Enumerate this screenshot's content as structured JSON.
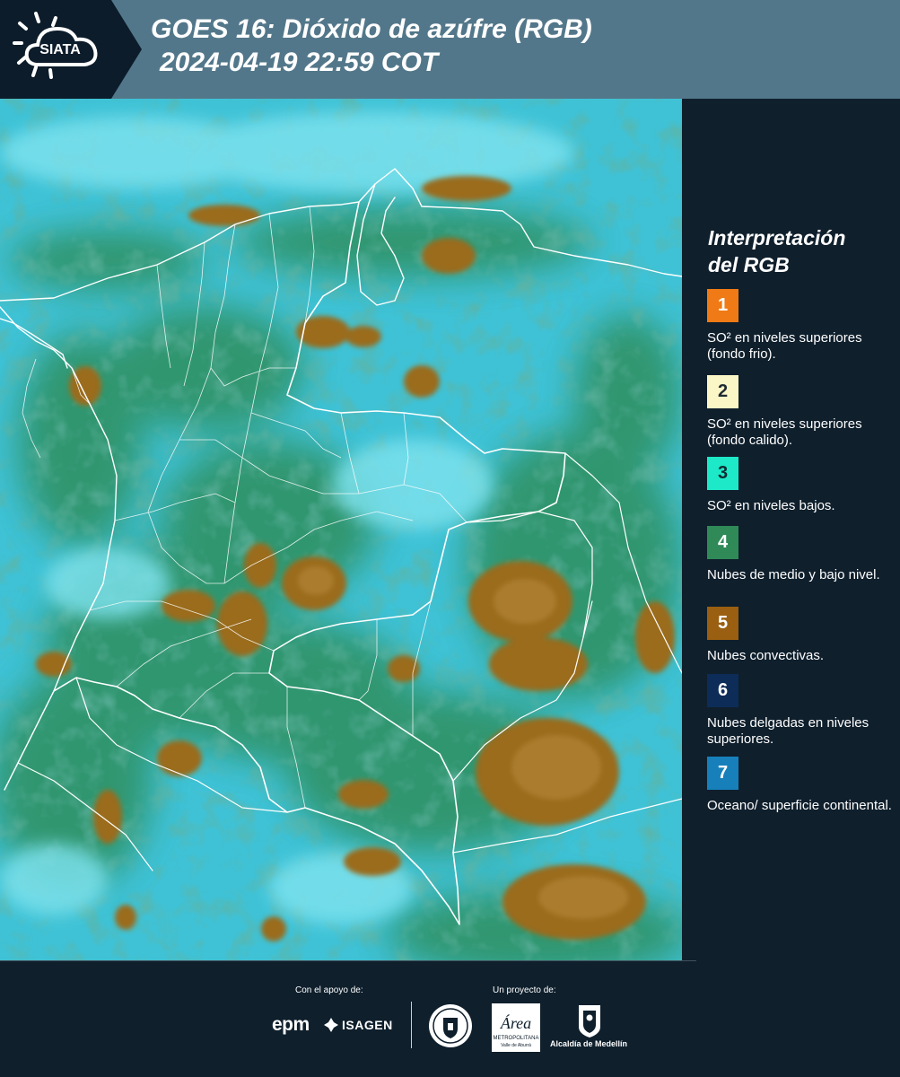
{
  "header": {
    "logo_text": "SIATA",
    "title_line1": "GOES 16: Dióxido de azúfre (RGB)",
    "title_line2": "2024-04-19 22:59 COT"
  },
  "legend": {
    "title_line1": "Interpretación",
    "title_line2": "del RGB",
    "items": [
      {
        "num": "1",
        "color": "#f07a15",
        "text_color": "#ffffff",
        "label": "SO² en niveles superiores (fondo frio)."
      },
      {
        "num": "2",
        "color": "#fbf6c6",
        "text_color": "#1e2a33",
        "label": "SO² en niveles superiores (fondo calido)."
      },
      {
        "num": "3",
        "color": "#1de9c9",
        "text_color": "#0f2b33",
        "label": "SO² en niveles bajos."
      },
      {
        "num": "4",
        "color": "#2f8a58",
        "text_color": "#ffffff",
        "label": "Nubes de medio y bajo nivel."
      },
      {
        "num": "5",
        "color": "#9a5f10",
        "text_color": "#ffffff",
        "label": "Nubes convectivas."
      },
      {
        "num": "6",
        "color": "#0d2c57",
        "text_color": "#ffffff",
        "label": "Nubes delgadas en niveles superiores."
      },
      {
        "num": "7",
        "color": "#1780bb",
        "text_color": "#ffffff",
        "label": "Oceano/ superficie continental."
      }
    ]
  },
  "footer": {
    "support_label": "Con el apoyo de:",
    "project_label": "Un proyecto de:",
    "sponsors": [
      "epm",
      "ISAGEN"
    ],
    "partners": [
      "Área Metropolitana Valle de Aburrá",
      "Alcaldía de Medellín"
    ],
    "epm_text": "epm",
    "isagen_text": "ISAGEN",
    "area_text": "Área",
    "area_sub": "METROPOLITANA",
    "area_sub2": "Valle de Aburrá",
    "alcaldia_text": "Alcaldía de Medellín"
  }
}
